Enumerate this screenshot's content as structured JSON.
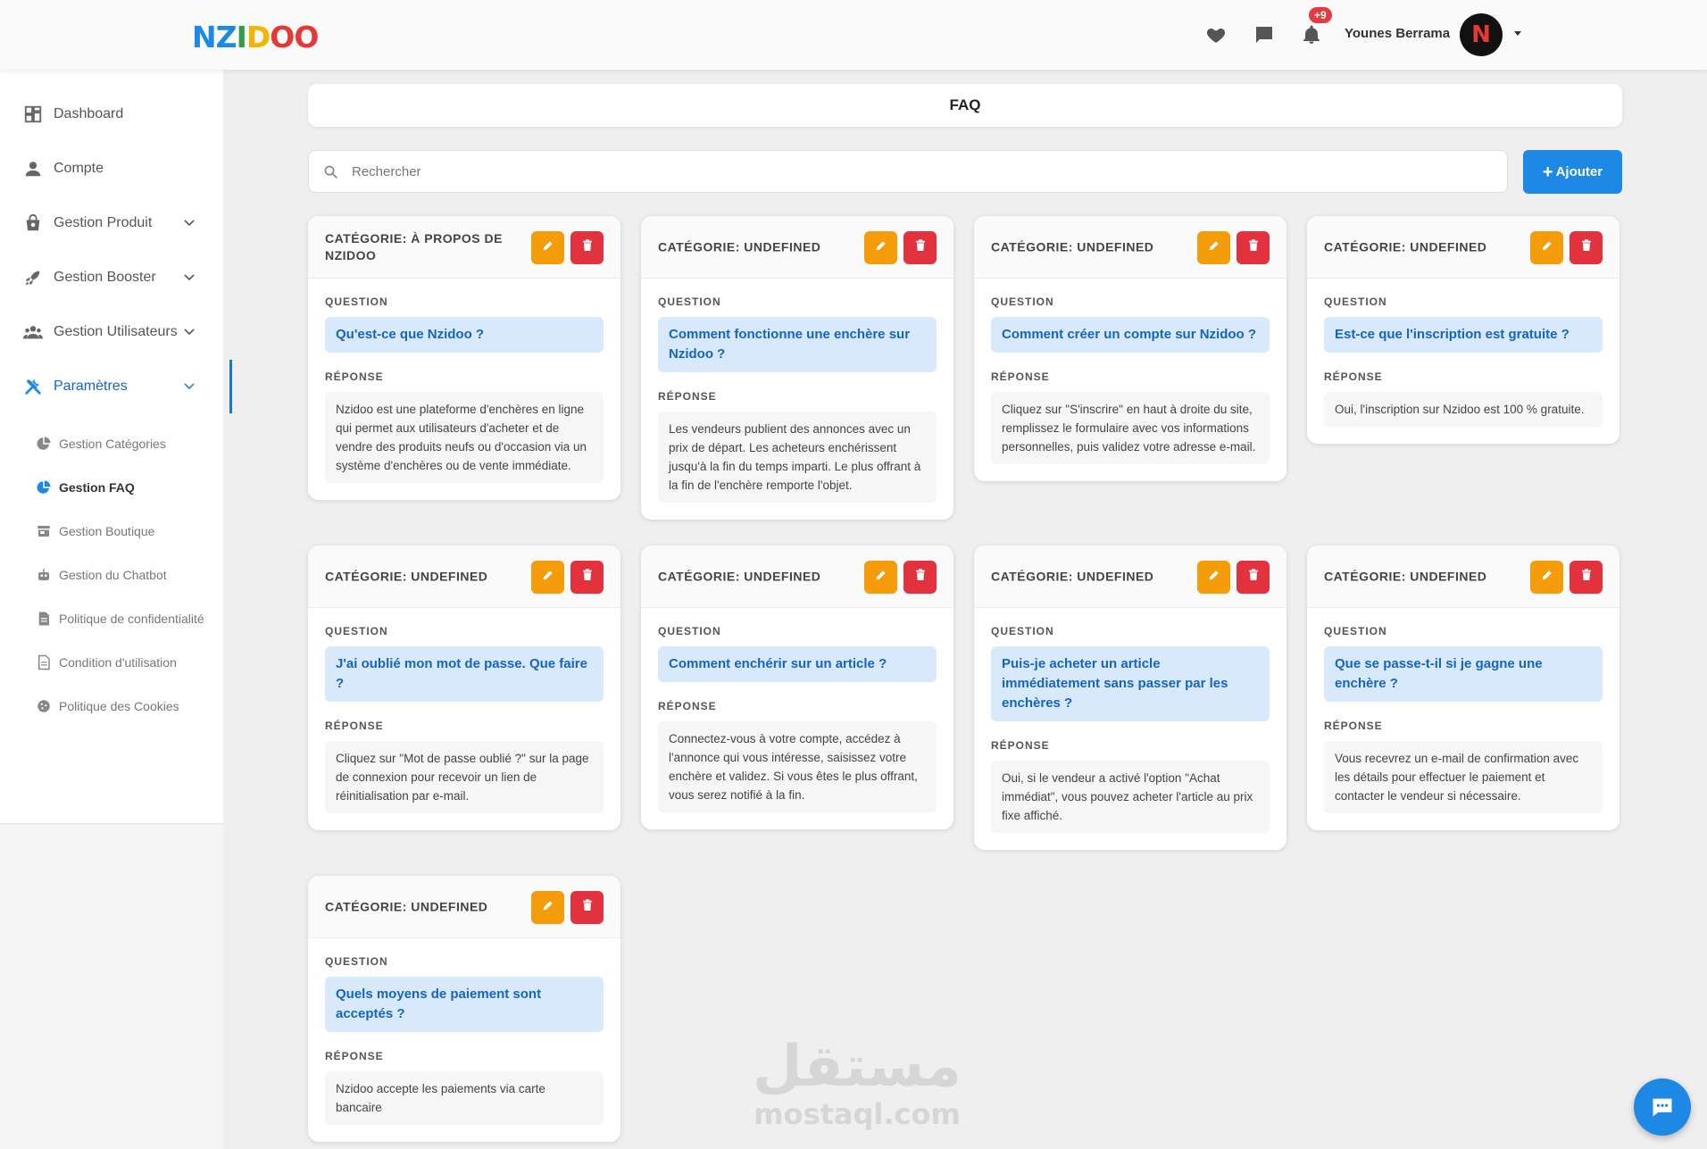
{
  "header": {
    "logo_letters": [
      {
        "ch": "N",
        "color": "#1e88e5"
      },
      {
        "ch": "Z",
        "color": "#1e88e5"
      },
      {
        "ch": "I",
        "color": "#2e9d4a"
      },
      {
        "ch": "D",
        "color": "#f5b400"
      },
      {
        "ch": "O",
        "color": "#e53935"
      },
      {
        "ch": "O",
        "color": "#e53935"
      }
    ],
    "icons": [
      "heart-icon",
      "chat-icon",
      "bell-icon"
    ],
    "notification_badge": "+9",
    "username": "Younes Berrama",
    "avatar_letter": "N"
  },
  "sidebar": {
    "items": [
      {
        "label": "Dashboard",
        "icon": "dashboard-icon",
        "has_chevron": false,
        "active": false
      },
      {
        "label": "Compte",
        "icon": "user-icon",
        "has_chevron": false,
        "active": false
      },
      {
        "label": "Gestion Produit",
        "icon": "shopping-bag-icon",
        "has_chevron": true,
        "active": false
      },
      {
        "label": "Gestion Booster",
        "icon": "rocket-icon",
        "has_chevron": true,
        "active": false
      },
      {
        "label": "Gestion Utilisateurs",
        "icon": "users-icon",
        "has_chevron": true,
        "active": false
      },
      {
        "label": "Paramètres",
        "icon": "tools-icon",
        "has_chevron": true,
        "active": true
      }
    ],
    "sub_items": [
      {
        "label": "Gestion Catégories",
        "icon": "pie-chart-icon",
        "active": false
      },
      {
        "label": "Gestion FAQ",
        "icon": "pie-chart-icon",
        "active": true
      },
      {
        "label": "Gestion Boutique",
        "icon": "store-icon",
        "active": false
      },
      {
        "label": "Gestion du Chatbot",
        "icon": "robot-icon",
        "active": false
      },
      {
        "label": "Politique de confidentialité",
        "icon": "document-icon",
        "active": false
      },
      {
        "label": "Condition d'utilisation",
        "icon": "document-outline-icon",
        "active": false
      },
      {
        "label": "Politique des Cookies",
        "icon": "cookie-icon",
        "active": false
      }
    ]
  },
  "page": {
    "title": "FAQ",
    "search_placeholder": "Rechercher",
    "add_button": "Ajouter",
    "section_question": "QUESTION",
    "section_answer": "RÉPONSE"
  },
  "faqs": [
    {
      "category": "CATÉGORIE: À PROPOS DE NZIDOO",
      "question": "Qu'est-ce que Nzidoo ?",
      "answer": "Nzidoo est une plateforme d'enchères en ligne qui permet aux utilisateurs d'acheter et de vendre des produits neufs ou d'occasion via un système d'enchères ou de vente immédiate."
    },
    {
      "category": "CATÉGORIE: UNDEFINED",
      "question": "Comment fonctionne une enchère sur Nzidoo ?",
      "answer": "Les vendeurs publient des annonces avec un prix de départ. Les acheteurs enchérissent jusqu'à la fin du temps imparti. Le plus offrant à la fin de l'enchère remporte l'objet."
    },
    {
      "category": "CATÉGORIE: UNDEFINED",
      "question": "Comment créer un compte sur Nzidoo ?",
      "answer": "Cliquez sur \"S'inscrire\" en haut à droite du site, remplissez le formulaire avec vos informations personnelles, puis validez votre adresse e-mail."
    },
    {
      "category": "CATÉGORIE: UNDEFINED",
      "question": "Est-ce que l'inscription est gratuite ?",
      "answer": "Oui, l'inscription sur Nzidoo est 100 % gratuite."
    },
    {
      "category": "CATÉGORIE: UNDEFINED",
      "question": "J'ai oublié mon mot de passe. Que faire ?",
      "answer": "Cliquez sur \"Mot de passe oublié ?\" sur la page de connexion pour recevoir un lien de réinitialisation par e-mail."
    },
    {
      "category": "CATÉGORIE: UNDEFINED",
      "question": "Comment enchérir sur un article ?",
      "answer": "Connectez-vous à votre compte, accédez à l'annonce qui vous intéresse, saisissez votre enchère et validez. Si vous êtes le plus offrant, vous serez notifié à la fin."
    },
    {
      "category": "CATÉGORIE: UNDEFINED",
      "question": "Puis-je acheter un article immédiatement sans passer par les enchères ?",
      "answer": "Oui, si le vendeur a activé l'option \"Achat immédiat\", vous pouvez acheter l'article au prix fixe affiché."
    },
    {
      "category": "CATÉGORIE: UNDEFINED",
      "question": "Que se passe-t-il si je gagne une enchère ?",
      "answer": "Vous recevrez un e-mail de confirmation avec les détails pour effectuer le paiement et contacter le vendeur si nécessaire."
    },
    {
      "category": "CATÉGORIE: UNDEFINED",
      "question": "Quels moyens de paiement sont acceptés ?",
      "answer": "Nzidoo accepte les paiements via carte bancaire"
    }
  ],
  "watermark": {
    "arabic": "مستقل",
    "latin": "mostaql.com"
  },
  "colors": {
    "primary": "#1e88e5",
    "edit": "#f59c0b",
    "delete": "#e2323e",
    "question_bg": "#d8e9fb",
    "question_text": "#1565c0"
  }
}
